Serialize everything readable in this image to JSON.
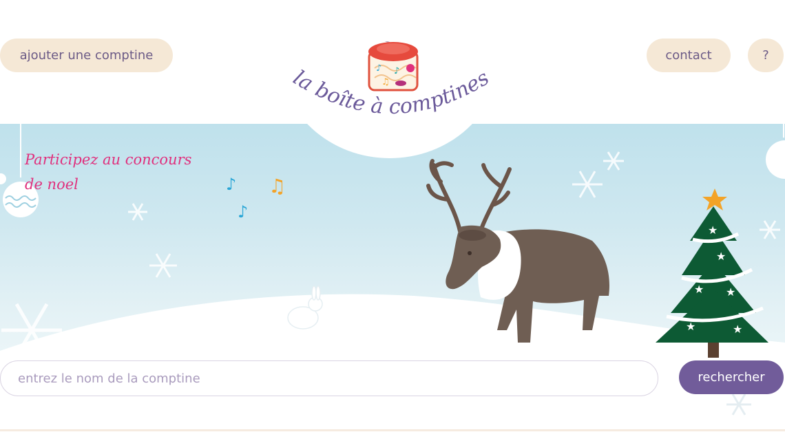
{
  "header": {
    "add_label": "ajouter une comptine",
    "contact_label": "contact",
    "help_label": "?"
  },
  "logo": {
    "title": "la boîte à comptines"
  },
  "banner": {
    "contest_line1": "Participez au concours",
    "contest_line2": "de noel"
  },
  "search": {
    "placeholder": "entrez le nom de la comptine",
    "button_label": "rechercher"
  },
  "colors": {
    "accent": "#715c9a",
    "pill_bg": "#f5e8d6",
    "contest_pink": "#e0307d",
    "sky": "#cfe8f0"
  },
  "icons": [
    "music-box-icon",
    "music-note-icon",
    "snowflake-icon",
    "ornament-icon",
    "reindeer",
    "rabbit",
    "christmas-tree"
  ]
}
